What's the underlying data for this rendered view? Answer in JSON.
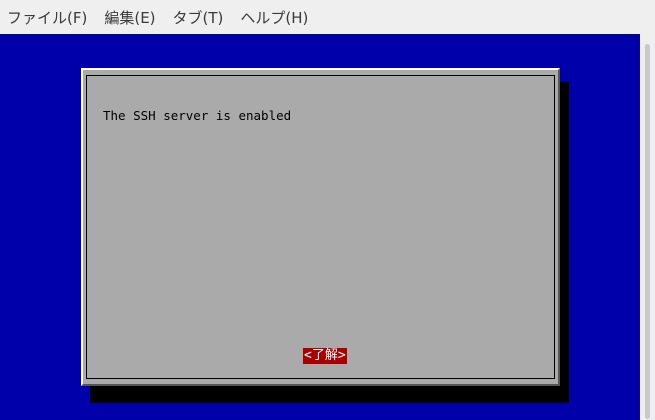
{
  "menubar": {
    "items": [
      {
        "label": "ファイル(F)"
      },
      {
        "label": "編集(E)"
      },
      {
        "label": "タブ(T)"
      },
      {
        "label": "ヘルプ(H)"
      }
    ]
  },
  "dialog": {
    "message": "The SSH server is enabled",
    "ok_label": "<了解>"
  },
  "colors": {
    "terminal_background": "#0000aa",
    "dialog_background": "#aaaaaa",
    "button_highlight": "#aa0000"
  }
}
